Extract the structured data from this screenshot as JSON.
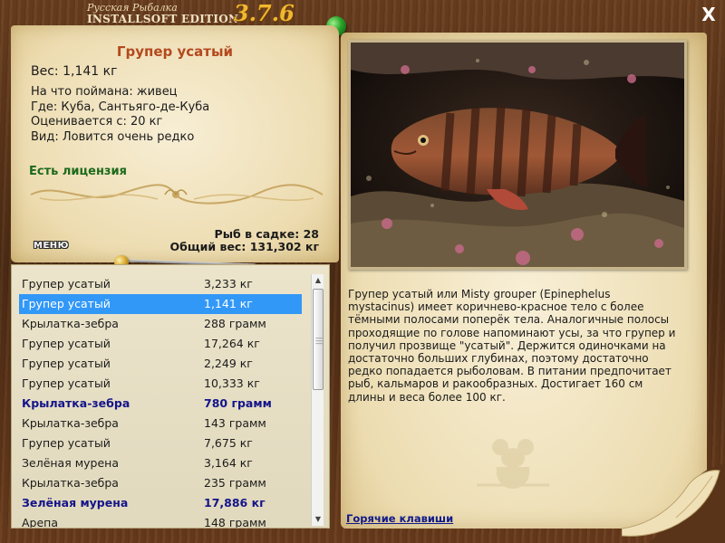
{
  "header": {
    "brand_line1": "Русская Рыбалка",
    "brand_line2": "INSTALLSOFT EDITION",
    "version": "3.7.6",
    "close_label": "X"
  },
  "fish_card": {
    "title": "Групер усатый",
    "weight": "Вес: 1,141 кг",
    "caught_on": "На что поймана: живец",
    "where": "Где: Куба, Сантьяго-де-Куба",
    "valued_from": "Оценивается с: 20 кг",
    "kind": "Вид: Ловится очень редко",
    "license": "Есть лицензия"
  },
  "stats": {
    "fish_in_keepnet": "Рыб в садке: 28",
    "total_weight": "Общий вес: 131,302 кг"
  },
  "menu_label": "МЕНЮ",
  "catch_list": [
    {
      "name": "Групер усатый",
      "weight": "3,233 кг",
      "state": "normal"
    },
    {
      "name": "Групер усатый",
      "weight": "1,141 кг",
      "state": "selected"
    },
    {
      "name": "Крылатка-зебра",
      "weight": "288 грамм",
      "state": "normal"
    },
    {
      "name": "Групер усатый",
      "weight": "17,264 кг",
      "state": "normal"
    },
    {
      "name": "Групер усатый",
      "weight": "2,249 кг",
      "state": "normal"
    },
    {
      "name": "Групер усатый",
      "weight": "10,333 кг",
      "state": "normal"
    },
    {
      "name": "Крылатка-зебра",
      "weight": "780 грамм",
      "state": "highlight"
    },
    {
      "name": "Крылатка-зебра",
      "weight": "143 грамм",
      "state": "normal"
    },
    {
      "name": "Групер усатый",
      "weight": "7,675 кг",
      "state": "normal"
    },
    {
      "name": "Зелёная мурена",
      "weight": "3,164 кг",
      "state": "normal"
    },
    {
      "name": "Крылатка-зебра",
      "weight": "235 грамм",
      "state": "normal"
    },
    {
      "name": "Зелёная мурена",
      "weight": "17,886 кг",
      "state": "highlight"
    },
    {
      "name": "Арепа",
      "weight": "148 грамм",
      "state": "normal"
    }
  ],
  "description": "Групер усатый или Misty grouper (Epinephelus mystacinus) имеет коричнево-красное тело с более тёмными полосами поперёк тела. Аналогичные полосы проходящие по голове напоминают усы, за что групер и получил прозвище \"усатый\". Держится одиночками на достаточно больших глубинах, поэтому достаточно редко попадается рыболовам. В питании предпочитает рыб, кальмаров и ракообразных. Достигает 160 см длины и веса более 100 кг.",
  "hotkeys_label": "Горячие клавиши",
  "colors": {
    "title": "#b4481e",
    "license": "#1c6a1c",
    "selected_row": "#3298f8",
    "highlight_row": "#14148a",
    "link": "#0f1a8a",
    "version": "#f0b830"
  },
  "icons": [
    "close-icon",
    "green-pin-icon",
    "brass-pin-icon",
    "needle-icon",
    "ornament-icon",
    "mouse-silhouette-icon",
    "page-curl-icon",
    "scroll-up-icon",
    "scroll-down-icon"
  ]
}
